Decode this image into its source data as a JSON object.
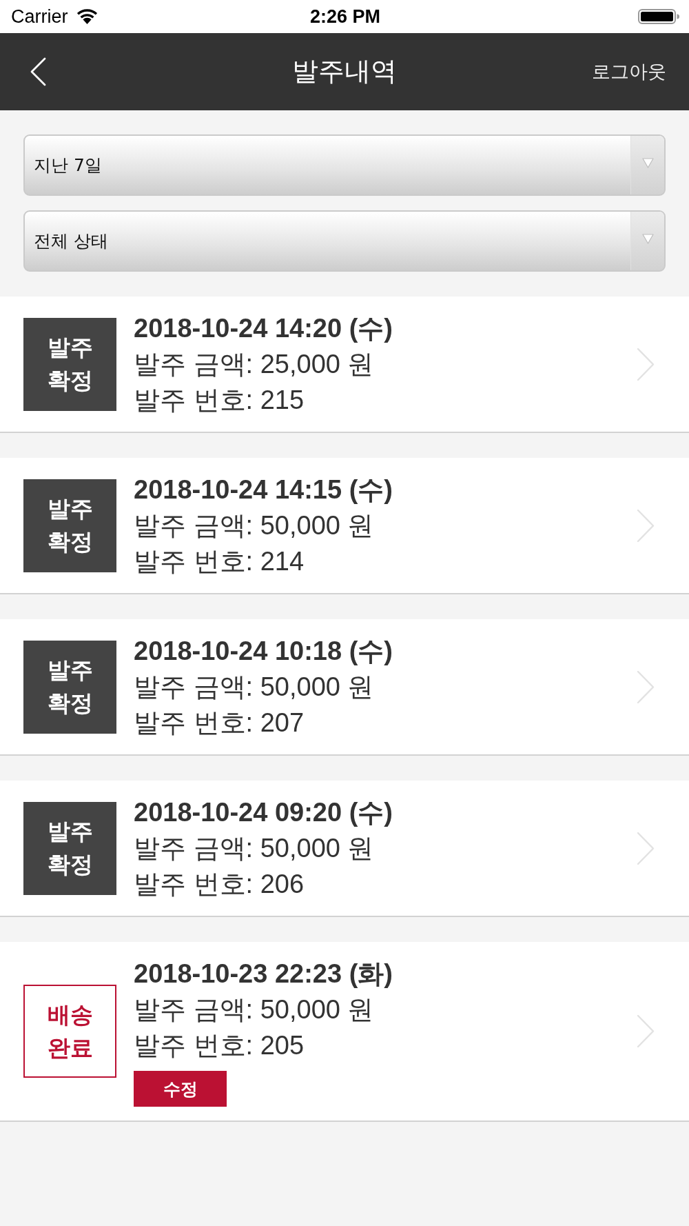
{
  "status_bar": {
    "carrier": "Carrier",
    "time": "2:26 PM"
  },
  "nav_bar": {
    "title": "발주내역",
    "action": "로그아웃"
  },
  "filters": [
    {
      "value": "지난 7일"
    },
    {
      "value": "전체 상태"
    }
  ],
  "orders": [
    {
      "status": {
        "kind": "confirmed",
        "label": "발주 확정"
      },
      "date": "2018-10-24 14:20 (수)",
      "amount": "발주 금액: 25,000 원",
      "number": "발주 번호: 215"
    },
    {
      "status": {
        "kind": "confirmed",
        "label": "발주 확정"
      },
      "date": "2018-10-24 14:15 (수)",
      "amount": "발주 금액: 50,000 원",
      "number": "발주 번호: 214"
    },
    {
      "status": {
        "kind": "confirmed",
        "label": "발주 확정"
      },
      "date": "2018-10-24 10:18 (수)",
      "amount": "발주 금액: 50,000 원",
      "number": "발주 번호: 207"
    },
    {
      "status": {
        "kind": "confirmed",
        "label": "발주 확정"
      },
      "date": "2018-10-24 09:20 (수)",
      "amount": "발주 금액: 50,000 원",
      "number": "발주 번호: 206"
    },
    {
      "status": {
        "kind": "delivered",
        "label": "배송 완료"
      },
      "date": "2018-10-23 22:23 (화)",
      "amount": "발주 금액: 50,000 원",
      "number": "발주 번호: 205",
      "edit_button": "수정"
    }
  ]
}
